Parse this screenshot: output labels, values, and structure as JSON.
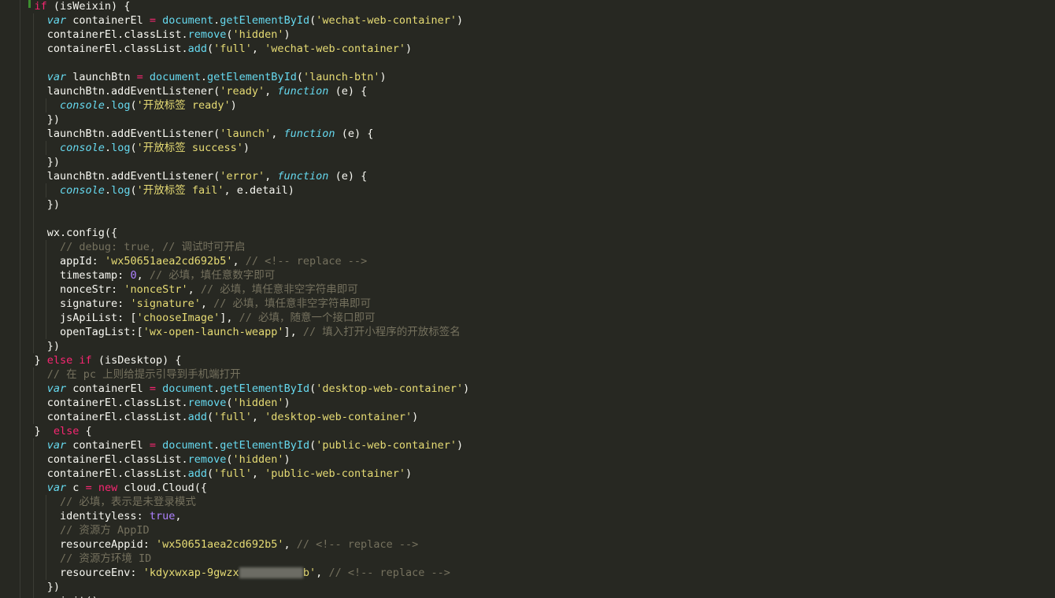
{
  "editor": {
    "theme_colors": {
      "background": "#272822",
      "plain": "#f8f8f2",
      "keyword": "#f92672",
      "string": "#e6db74",
      "function": "#66d9ef",
      "number": "#ae81ff",
      "comment": "#75715e",
      "gutter_marker": "#3c8e2f"
    },
    "lines": [
      [
        [
          "ws",
          "    "
        ],
        [
          "kw",
          "if"
        ],
        [
          "pl",
          " (isWeixin) {"
        ]
      ],
      [
        [
          "ws",
          "      "
        ],
        [
          "ty",
          "var"
        ],
        [
          "pl",
          " containerEl "
        ],
        [
          "kw",
          "="
        ],
        [
          "pl",
          " "
        ],
        [
          "fn",
          "document"
        ],
        [
          "pl",
          "."
        ],
        [
          "fn",
          "getElementById"
        ],
        [
          "pl",
          "("
        ],
        [
          "st",
          "'wechat-web-container'"
        ],
        [
          "pl",
          ")"
        ]
      ],
      [
        [
          "ws",
          "      "
        ],
        [
          "pl",
          "containerEl.classList."
        ],
        [
          "fn",
          "remove"
        ],
        [
          "pl",
          "("
        ],
        [
          "st",
          "'hidden'"
        ],
        [
          "pl",
          ")"
        ]
      ],
      [
        [
          "ws",
          "      "
        ],
        [
          "pl",
          "containerEl.classList."
        ],
        [
          "fn",
          "add"
        ],
        [
          "pl",
          "("
        ],
        [
          "st",
          "'full'"
        ],
        [
          "pl",
          ", "
        ],
        [
          "st",
          "'wechat-web-container'"
        ],
        [
          "pl",
          ")"
        ]
      ],
      [],
      [
        [
          "ws",
          "      "
        ],
        [
          "ty",
          "var"
        ],
        [
          "pl",
          " launchBtn "
        ],
        [
          "kw",
          "="
        ],
        [
          "pl",
          " "
        ],
        [
          "fn",
          "document"
        ],
        [
          "pl",
          "."
        ],
        [
          "fn",
          "getElementById"
        ],
        [
          "pl",
          "("
        ],
        [
          "st",
          "'launch-btn'"
        ],
        [
          "pl",
          ")"
        ]
      ],
      [
        [
          "ws",
          "      "
        ],
        [
          "pl",
          "launchBtn.addEventListener("
        ],
        [
          "st",
          "'ready'"
        ],
        [
          "pl",
          ", "
        ],
        [
          "ty",
          "function"
        ],
        [
          "pl",
          " (e) {"
        ]
      ],
      [
        [
          "ws",
          "        "
        ],
        [
          "ty",
          "console"
        ],
        [
          "pl",
          "."
        ],
        [
          "fn",
          "log"
        ],
        [
          "pl",
          "("
        ],
        [
          "st",
          "'开放标签 ready'"
        ],
        [
          "pl",
          ")"
        ]
      ],
      [
        [
          "ws",
          "      "
        ],
        [
          "pl",
          "})"
        ]
      ],
      [
        [
          "ws",
          "      "
        ],
        [
          "pl",
          "launchBtn.addEventListener("
        ],
        [
          "st",
          "'launch'"
        ],
        [
          "pl",
          ", "
        ],
        [
          "ty",
          "function"
        ],
        [
          "pl",
          " (e) {"
        ]
      ],
      [
        [
          "ws",
          "        "
        ],
        [
          "ty",
          "console"
        ],
        [
          "pl",
          "."
        ],
        [
          "fn",
          "log"
        ],
        [
          "pl",
          "("
        ],
        [
          "st",
          "'开放标签 success'"
        ],
        [
          "pl",
          ")"
        ]
      ],
      [
        [
          "ws",
          "      "
        ],
        [
          "pl",
          "})"
        ]
      ],
      [
        [
          "ws",
          "      "
        ],
        [
          "pl",
          "launchBtn.addEventListener("
        ],
        [
          "st",
          "'error'"
        ],
        [
          "pl",
          ", "
        ],
        [
          "ty",
          "function"
        ],
        [
          "pl",
          " (e) {"
        ]
      ],
      [
        [
          "ws",
          "        "
        ],
        [
          "ty",
          "console"
        ],
        [
          "pl",
          "."
        ],
        [
          "fn",
          "log"
        ],
        [
          "pl",
          "("
        ],
        [
          "st",
          "'开放标签 fail'"
        ],
        [
          "pl",
          ", e.detail)"
        ]
      ],
      [
        [
          "ws",
          "      "
        ],
        [
          "pl",
          "})"
        ]
      ],
      [],
      [
        [
          "ws",
          "      "
        ],
        [
          "pl",
          "wx.config({"
        ]
      ],
      [
        [
          "ws",
          "        "
        ],
        [
          "cm",
          "// debug: true, // 调试时可开启"
        ]
      ],
      [
        [
          "ws",
          "        "
        ],
        [
          "pl",
          "appId: "
        ],
        [
          "st",
          "'wx50651aea2cd692b5'"
        ],
        [
          "pl",
          ", "
        ],
        [
          "cm",
          "// <!-- replace -->"
        ]
      ],
      [
        [
          "ws",
          "        "
        ],
        [
          "pl",
          "timestamp: "
        ],
        [
          "nu",
          "0"
        ],
        [
          "pl",
          ", "
        ],
        [
          "cm",
          "// 必填，填任意数字即可"
        ]
      ],
      [
        [
          "ws",
          "        "
        ],
        [
          "pl",
          "nonceStr: "
        ],
        [
          "st",
          "'nonceStr'"
        ],
        [
          "pl",
          ", "
        ],
        [
          "cm",
          "// 必填，填任意非空字符串即可"
        ]
      ],
      [
        [
          "ws",
          "        "
        ],
        [
          "pl",
          "signature: "
        ],
        [
          "st",
          "'signature'"
        ],
        [
          "pl",
          ", "
        ],
        [
          "cm",
          "// 必填，填任意非空字符串即可"
        ]
      ],
      [
        [
          "ws",
          "        "
        ],
        [
          "pl",
          "jsApiList: ["
        ],
        [
          "st",
          "'chooseImage'"
        ],
        [
          "pl",
          "], "
        ],
        [
          "cm",
          "// 必填，随意一个接口即可"
        ]
      ],
      [
        [
          "ws",
          "        "
        ],
        [
          "pl",
          "openTagList:["
        ],
        [
          "st",
          "'wx-open-launch-weapp'"
        ],
        [
          "pl",
          "], "
        ],
        [
          "cm",
          "// 填入打开小程序的开放标签名"
        ]
      ],
      [
        [
          "ws",
          "      "
        ],
        [
          "pl",
          "})"
        ]
      ],
      [
        [
          "ws",
          "    "
        ],
        [
          "pl",
          "} "
        ],
        [
          "kw",
          "else if"
        ],
        [
          "pl",
          " (isDesktop) {"
        ]
      ],
      [
        [
          "ws",
          "      "
        ],
        [
          "cm",
          "// 在 pc 上则给提示引导到手机端打开"
        ]
      ],
      [
        [
          "ws",
          "      "
        ],
        [
          "ty",
          "var"
        ],
        [
          "pl",
          " containerEl "
        ],
        [
          "kw",
          "="
        ],
        [
          "pl",
          " "
        ],
        [
          "fn",
          "document"
        ],
        [
          "pl",
          "."
        ],
        [
          "fn",
          "getElementById"
        ],
        [
          "pl",
          "("
        ],
        [
          "st",
          "'desktop-web-container'"
        ],
        [
          "pl",
          ")"
        ]
      ],
      [
        [
          "ws",
          "      "
        ],
        [
          "pl",
          "containerEl.classList."
        ],
        [
          "fn",
          "remove"
        ],
        [
          "pl",
          "("
        ],
        [
          "st",
          "'hidden'"
        ],
        [
          "pl",
          ")"
        ]
      ],
      [
        [
          "ws",
          "      "
        ],
        [
          "pl",
          "containerEl.classList."
        ],
        [
          "fn",
          "add"
        ],
        [
          "pl",
          "("
        ],
        [
          "st",
          "'full'"
        ],
        [
          "pl",
          ", "
        ],
        [
          "st",
          "'desktop-web-container'"
        ],
        [
          "pl",
          ")"
        ]
      ],
      [
        [
          "ws",
          "    "
        ],
        [
          "pl",
          "}  "
        ],
        [
          "kw",
          "else"
        ],
        [
          "pl",
          " {"
        ]
      ],
      [
        [
          "ws",
          "      "
        ],
        [
          "ty",
          "var"
        ],
        [
          "pl",
          " containerEl "
        ],
        [
          "kw",
          "="
        ],
        [
          "pl",
          " "
        ],
        [
          "fn",
          "document"
        ],
        [
          "pl",
          "."
        ],
        [
          "fn",
          "getElementById"
        ],
        [
          "pl",
          "("
        ],
        [
          "st",
          "'public-web-container'"
        ],
        [
          "pl",
          ")"
        ]
      ],
      [
        [
          "ws",
          "      "
        ],
        [
          "pl",
          "containerEl.classList."
        ],
        [
          "fn",
          "remove"
        ],
        [
          "pl",
          "("
        ],
        [
          "st",
          "'hidden'"
        ],
        [
          "pl",
          ")"
        ]
      ],
      [
        [
          "ws",
          "      "
        ],
        [
          "pl",
          "containerEl.classList."
        ],
        [
          "fn",
          "add"
        ],
        [
          "pl",
          "("
        ],
        [
          "st",
          "'full'"
        ],
        [
          "pl",
          ", "
        ],
        [
          "st",
          "'public-web-container'"
        ],
        [
          "pl",
          ")"
        ]
      ],
      [
        [
          "ws",
          "      "
        ],
        [
          "ty",
          "var"
        ],
        [
          "pl",
          " c "
        ],
        [
          "kw",
          "="
        ],
        [
          "pl",
          " "
        ],
        [
          "kw",
          "new"
        ],
        [
          "pl",
          " cloud.Cloud({"
        ]
      ],
      [
        [
          "ws",
          "        "
        ],
        [
          "cm",
          "// 必填，表示是未登录模式"
        ]
      ],
      [
        [
          "ws",
          "        "
        ],
        [
          "pl",
          "identityless: "
        ],
        [
          "nu",
          "true"
        ],
        [
          "pl",
          ","
        ]
      ],
      [
        [
          "ws",
          "        "
        ],
        [
          "cm",
          "// 资源方 AppID"
        ]
      ],
      [
        [
          "ws",
          "        "
        ],
        [
          "pl",
          "resourceAppid: "
        ],
        [
          "st",
          "'wx50651aea2cd692b5'"
        ],
        [
          "pl",
          ", "
        ],
        [
          "cm",
          "// <!-- replace -->"
        ]
      ],
      [
        [
          "ws",
          "        "
        ],
        [
          "cm",
          "// 资源方环境 ID"
        ]
      ],
      [
        [
          "ws",
          "        "
        ],
        [
          "pl",
          "resourceEnv: "
        ],
        [
          "st",
          "'kdyxwxap-9gwzx"
        ],
        [
          "bl",
          "          "
        ],
        [
          "st",
          "b'"
        ],
        [
          "pl",
          ", "
        ],
        [
          "cm",
          "// <!-- replace -->"
        ]
      ],
      [
        [
          "ws",
          "      "
        ],
        [
          "pl",
          "})"
        ]
      ],
      [
        [
          "ws",
          "      "
        ],
        [
          "pl",
          "c.init()"
        ]
      ]
    ]
  }
}
